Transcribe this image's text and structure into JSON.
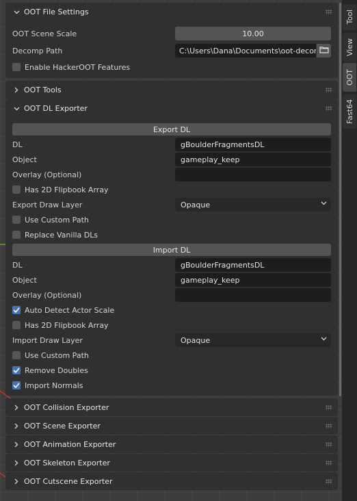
{
  "tabs": [
    {
      "label": "Tool",
      "active": false
    },
    {
      "label": "View",
      "active": false
    },
    {
      "label": "OOT",
      "active": true
    },
    {
      "label": "Fast64",
      "active": false
    }
  ],
  "file_settings": {
    "title": "OOT File Settings",
    "scene_scale_label": "OOT Scene Scale",
    "scene_scale_value": "10.00",
    "decomp_path_label": "Decomp Path",
    "decomp_path_value": "C:\\Users\\Dana\\Documents\\oot-decomp\\",
    "hackeroot_label": "Enable HackerOOT Features",
    "hackeroot_checked": false
  },
  "tools": {
    "title": "OOT Tools"
  },
  "dl_exporter": {
    "title": "OOT DL Exporter",
    "export_button": "Export DL",
    "export": {
      "dl_label": "DL",
      "dl_value": "gBoulderFragmentsDL",
      "object_label": "Object",
      "object_value": "gameplay_keep",
      "overlay_label": "Overlay (Optional)",
      "overlay_value": "",
      "flipbook_label": "Has 2D Flipbook Array",
      "flipbook_checked": false,
      "draw_layer_label": "Export Draw Layer",
      "draw_layer_value": "Opaque",
      "custom_path_label": "Use Custom Path",
      "custom_path_checked": false,
      "replace_vanilla_label": "Replace Vanilla DLs",
      "replace_vanilla_checked": false
    },
    "import_button": "Import DL",
    "import": {
      "dl_label": "DL",
      "dl_value": "gBoulderFragmentsDL",
      "object_label": "Object",
      "object_value": "gameplay_keep",
      "overlay_label": "Overlay (Optional)",
      "overlay_value": "",
      "auto_detect_label": "Auto Detect Actor Scale",
      "auto_detect_checked": true,
      "flipbook_label": "Has 2D Flipbook Array",
      "flipbook_checked": false,
      "draw_layer_label": "Import Draw Layer",
      "draw_layer_value": "Opaque",
      "custom_path_label": "Use Custom Path",
      "custom_path_checked": false,
      "remove_doubles_label": "Remove Doubles",
      "remove_doubles_checked": true,
      "import_normals_label": "Import Normals",
      "import_normals_checked": true
    }
  },
  "collapsed_panels": [
    {
      "title": "OOT Collision Exporter"
    },
    {
      "title": "OOT Scene Exporter"
    },
    {
      "title": "OOT Animation Exporter"
    },
    {
      "title": "OOT Skeleton Exporter"
    },
    {
      "title": "OOT Cutscene Exporter"
    }
  ],
  "colors": {
    "checkbox_on": "#4772b3",
    "panel_bg": "#303030",
    "field_bg": "#1d1d1d",
    "button_bg": "#545454"
  },
  "icons": {
    "expanded": "chevron-down-icon",
    "collapsed": "chevron-right-icon",
    "folder": "folder-icon",
    "drag": "drag-handle-icon",
    "check": "check-icon"
  }
}
